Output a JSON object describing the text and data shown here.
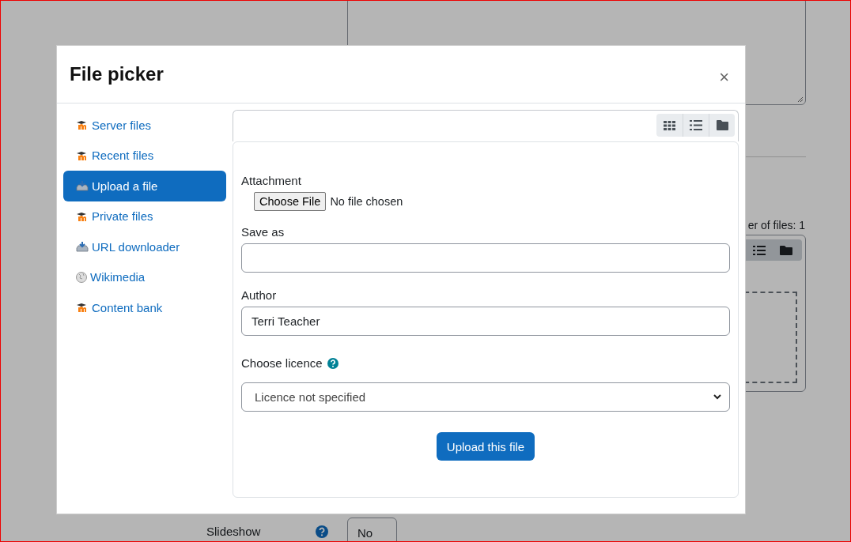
{
  "background": {
    "files_count": "er of files: 1",
    "slideshow_label": "Slideshow",
    "slideshow_value": "No"
  },
  "dialog": {
    "title": "File picker",
    "close": "×",
    "repositories": [
      {
        "label": "Server files",
        "kind": "moodle",
        "selected": false
      },
      {
        "label": "Recent files",
        "kind": "moodle",
        "selected": false
      },
      {
        "label": "Upload a file",
        "kind": "upload",
        "selected": true
      },
      {
        "label": "Private files",
        "kind": "moodle",
        "selected": false
      },
      {
        "label": "URL downloader",
        "kind": "upload",
        "selected": false
      },
      {
        "label": "Wikimedia",
        "kind": "wikimedia",
        "selected": false
      },
      {
        "label": "Content bank",
        "kind": "moodle",
        "selected": false
      }
    ],
    "form": {
      "attachment_label": "Attachment",
      "choose_button": "Choose File",
      "file_status": "No file chosen",
      "save_as_label": "Save as",
      "author_label": "Author",
      "author_value": "Terri Teacher",
      "licence_label": "Choose licence",
      "licence_value": "Licence not specified",
      "submit": "Upload this file"
    }
  }
}
